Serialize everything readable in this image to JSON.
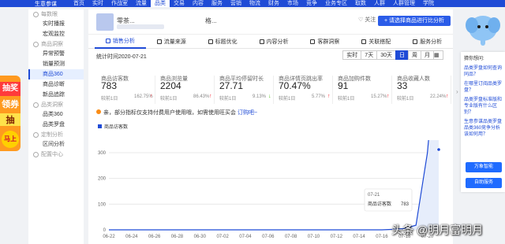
{
  "topnav": {
    "brand": "生意参谋",
    "items": [
      "首页",
      "实时",
      "作战室",
      "流量",
      "品类",
      "交易",
      "内容",
      "服务",
      "营销",
      "物流",
      "财务",
      "市场",
      "竞争",
      "业务专区",
      "取数",
      "人群",
      "人群管理",
      "学院"
    ],
    "active_index": 4
  },
  "promo": {
    "line1": "抽奖",
    "line2": "领券",
    "line3": "抽",
    "line4": "马上"
  },
  "sidebar": {
    "groups": [
      {
        "label": "每数眼",
        "items": [
          "实时播报",
          "宏观监控"
        ]
      },
      {
        "label": "商品洞察",
        "items": [
          "异常预警",
          "销量预测",
          "商品360",
          "商品诊断",
          "新品追踪"
        ]
      },
      {
        "label": "品类洞察",
        "items": [
          "品类360",
          "品类罗盘"
        ]
      },
      {
        "label": "定制分析",
        "items": [
          "区间分析"
        ]
      },
      {
        "label": "配置中心",
        "items": []
      }
    ],
    "active_item": "商品360"
  },
  "header": {
    "product_name": "零茶...",
    "product_name_tail": "格...",
    "follow_label": "♡ 关注",
    "compare_button": "+ 请选择商品进行比分析"
  },
  "tabs": [
    "销售分析",
    "流量来源",
    "标题优化",
    "内容分析",
    "客群洞察",
    "关联搭配",
    "服务分析"
  ],
  "active_tab": "销售分析",
  "date_label": "统计时间2020-07-21",
  "periods": [
    "实时",
    "7天",
    "30天",
    "日",
    "周",
    "月"
  ],
  "active_period": "日",
  "metrics": [
    {
      "label": "商品访客数",
      "value": "783",
      "compare": "较前1日",
      "pct": "162.75%",
      "trend": "up"
    },
    {
      "label": "商品浏览量",
      "value": "2204",
      "compare": "较前1日",
      "pct": "86.43%",
      "trend": "up"
    },
    {
      "label": "商品平均停留时长",
      "value": "27.71",
      "compare": "较前1日",
      "pct": "9.13%",
      "trend": "down"
    },
    {
      "label": "商品详情页跳出率",
      "value": "70.47%",
      "compare": "较前1日",
      "pct": "5.77%",
      "trend": "up"
    },
    {
      "label": "商品加购件数",
      "value": "91",
      "compare": "较前1日",
      "pct": "15.27%",
      "trend": "up"
    },
    {
      "label": "商品收藏人数",
      "value": "33",
      "compare": "较前1日",
      "pct": "22.24%",
      "trend": "up"
    }
  ],
  "notice": {
    "text": "亲，部分指标仅支持付费用户使用哦，如需使用旺买会 ",
    "link": "订购吧~"
  },
  "legend_label": "商品访客数",
  "tooltip": {
    "date": "07-21",
    "label": "商品访客数",
    "value": "783"
  },
  "right_panel": {
    "title": "猜你想问:",
    "questions": [
      "品类罗盘如何查询同品？",
      "在哪里订阅品类罗盘？",
      "品类罗盘标准版和专业版有什么区别？",
      "生意参谋品类罗盘品类360竞争分析该如何用？"
    ],
    "buttons": [
      "万象智能",
      "自助服务"
    ]
  },
  "watermark": "头条 @明月富明月",
  "colors": {
    "primary": "#1f4bd6",
    "up": "#f5222d",
    "down": "#52c41a"
  },
  "chart_data": {
    "type": "line",
    "x": [
      "06-22",
      "06-23",
      "06-24",
      "06-25",
      "06-26",
      "06-27",
      "06-28",
      "06-29",
      "06-30",
      "07-01",
      "07-02",
      "07-03",
      "07-04",
      "07-05",
      "07-06",
      "07-07",
      "07-08",
      "07-09",
      "07-10",
      "07-11",
      "07-12",
      "07-13",
      "07-14",
      "07-15",
      "07-16",
      "07-17",
      "07-18",
      "07-19",
      "07-20",
      "07-21"
    ],
    "x_ticks": [
      "06-22",
      "06-24",
      "06-26",
      "06-28",
      "06-30",
      "07-02",
      "07-04",
      "07-06",
      "07-08",
      "07-10",
      "07-12",
      "07-14",
      "07-16",
      "07-18",
      "07-20"
    ],
    "series": [
      {
        "name": "商品访客数",
        "values": [
          0,
          0,
          0,
          0,
          0,
          0,
          0,
          0,
          0,
          0,
          0,
          0,
          0,
          0,
          0,
          0,
          0,
          0,
          0,
          0,
          0,
          0,
          0,
          0,
          0,
          2,
          5,
          18,
          298,
          783
        ]
      }
    ],
    "y_ticks": [
      0,
      100,
      200,
      300
    ],
    "ylim": [
      0,
      300
    ]
  }
}
